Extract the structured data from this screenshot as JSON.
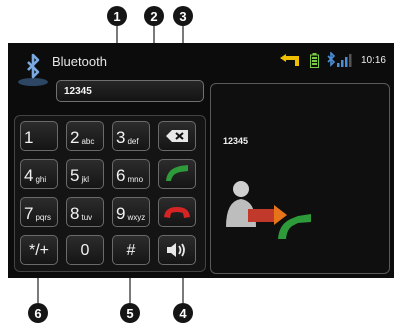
{
  "header": {
    "title": "Bluetooth",
    "time": "10:16"
  },
  "number_field": {
    "value": "12345"
  },
  "keypad": {
    "keys": [
      {
        "digit": "1",
        "letters": ""
      },
      {
        "digit": "2",
        "letters": "abc"
      },
      {
        "digit": "3",
        "letters": "def"
      },
      {
        "digit": "4",
        "letters": "ghi"
      },
      {
        "digit": "5",
        "letters": "jkl"
      },
      {
        "digit": "6",
        "letters": "mno"
      },
      {
        "digit": "7",
        "letters": "pqrs"
      },
      {
        "digit": "8",
        "letters": "tuv"
      },
      {
        "digit": "9",
        "letters": "wxyz"
      },
      {
        "digit": "*/+",
        "letters": ""
      },
      {
        "digit": "0",
        "letters": ""
      },
      {
        "digit": "#",
        "letters": ""
      }
    ]
  },
  "call_panel": {
    "number": "12345"
  },
  "callouts": [
    "1",
    "2",
    "3",
    "4",
    "5",
    "6"
  ],
  "colors": {
    "accept": "#2e9b3a",
    "reject": "#d62424",
    "accent": "#f0c000",
    "bt_blue": "#4a90d9"
  },
  "icons": [
    "bluetooth-icon",
    "navigation-arrow-icon",
    "battery-icon",
    "signal-strength-icon",
    "backspace-icon",
    "call-accept-icon",
    "call-end-icon",
    "speaker-volume-icon",
    "caller-transfer-icon"
  ]
}
